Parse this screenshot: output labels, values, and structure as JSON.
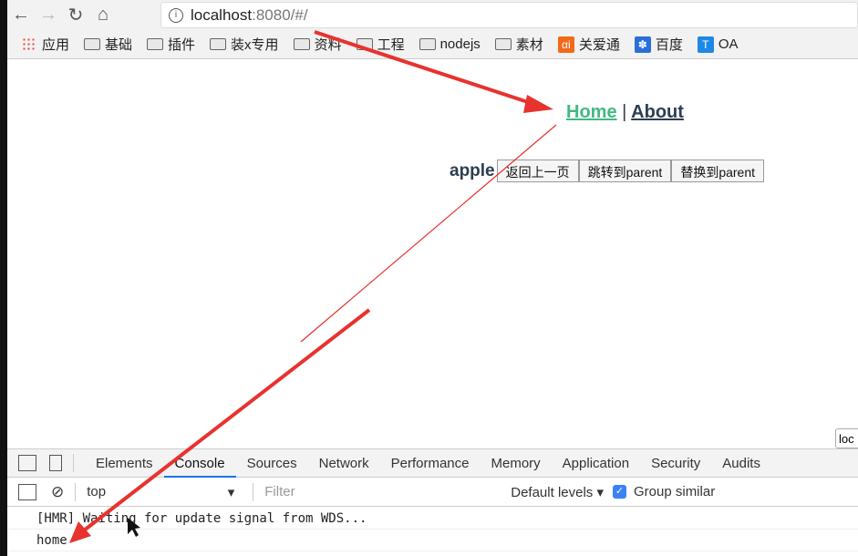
{
  "browser": {
    "url_host": "localhost",
    "url_rest": ":8080/#/",
    "bookmarks": [
      {
        "label": "应用",
        "icon": "apps-icon"
      },
      {
        "label": "基础",
        "icon": "folder-icon"
      },
      {
        "label": "插件",
        "icon": "folder-icon"
      },
      {
        "label": "装x专用",
        "icon": "folder-icon"
      },
      {
        "label": "资料",
        "icon": "folder-icon"
      },
      {
        "label": "工程",
        "icon": "folder-icon"
      },
      {
        "label": "nodejs",
        "icon": "folder-icon"
      },
      {
        "label": "素材",
        "icon": "folder-icon"
      },
      {
        "label": "关爱通",
        "icon": "ai-icon",
        "color": "#f06a1a"
      },
      {
        "label": "百度",
        "icon": "baidu-icon",
        "color": "#2a6fd6"
      },
      {
        "label": "OA",
        "icon": "t-icon",
        "color": "#1e88e5"
      }
    ]
  },
  "page": {
    "nav_home": "Home",
    "nav_sep": "|",
    "nav_about": "About",
    "fruit": "apple",
    "buttons": [
      "返回上一页",
      "跳转到parent",
      "替换到parent"
    ],
    "lock_box": "loc"
  },
  "devtools": {
    "tabs": [
      "Elements",
      "Console",
      "Sources",
      "Network",
      "Performance",
      "Memory",
      "Application",
      "Security",
      "Audits"
    ],
    "active_tab": "Console",
    "context": "top",
    "filter_placeholder": "Filter",
    "levels": "Default levels ▾",
    "group_similar": "Group similar",
    "group_similar_checked": true,
    "console_lines": [
      "[HMR] Waiting for update signal from WDS...",
      "home"
    ]
  },
  "colors": {
    "active_link": "#42b983",
    "annotation_arrow": "#e8322e"
  }
}
